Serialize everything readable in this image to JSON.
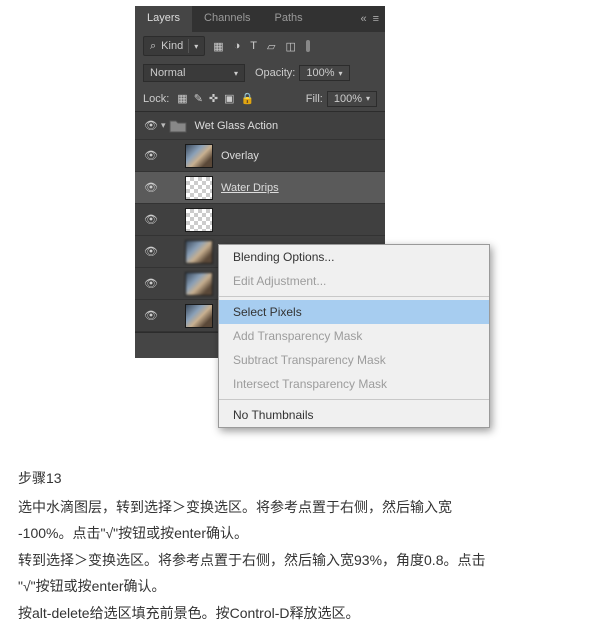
{
  "tabs": {
    "layers": "Layers",
    "channels": "Channels",
    "paths": "Paths"
  },
  "filter": {
    "kind": "Kind"
  },
  "blend": {
    "mode": "Normal",
    "opacity_label": "Opacity:",
    "opacity_value": "100%"
  },
  "lock": {
    "label": "Lock:",
    "fill_label": "Fill:",
    "fill_value": "100%"
  },
  "layers": {
    "group": "Wet Glass Action",
    "items": [
      "Overlay",
      "Water Drips"
    ]
  },
  "context_menu": {
    "blending": "Blending Options...",
    "edit_adj": "Edit Adjustment...",
    "select_pixels": "Select Pixels",
    "add_mask": "Add Transparency Mask",
    "sub_mask": "Subtract Transparency Mask",
    "int_mask": "Intersect Transparency Mask",
    "no_thumb": "No Thumbnails"
  },
  "instructions": {
    "title": "步骤13",
    "p1": "选中水滴图层，转到选择＞变换选区。将参考点置于右侧，然后输入宽",
    "p2": "-100%。点击\"√\"按钮或按enter确认。",
    "p3": "转到选择＞变换选区。将参考点置于右侧，然后输入宽93%，角度0.8。点击",
    "p4": "\"√\"按钮或按enter确认。",
    "p5": "按alt-delete给选区填充前景色。按Control-D释放选区。"
  }
}
